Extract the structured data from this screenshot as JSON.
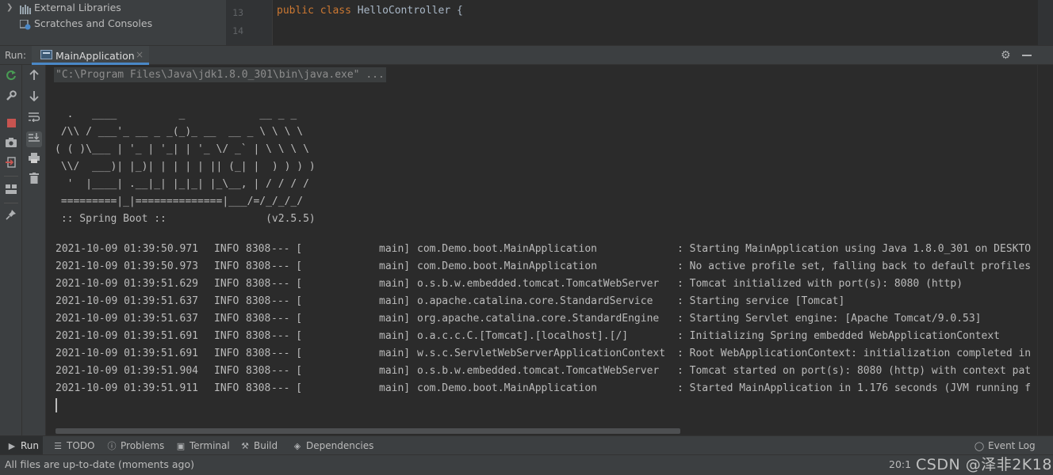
{
  "project_tree": {
    "items": [
      {
        "label": "External Libraries",
        "icon": "library-icon"
      },
      {
        "label": "Scratches and Consoles",
        "icon": "scratches-icon"
      }
    ]
  },
  "editor": {
    "line_numbers": [
      "13",
      "14"
    ],
    "line13": {
      "kw1": "public",
      "kw2": "class",
      "name": "HelloController",
      "brace": "{"
    }
  },
  "run_window": {
    "title": "Run:",
    "tab_label": "MainApplication",
    "tab_close": "×"
  },
  "console": {
    "command": "\"C:\\Program Files\\Java\\jdk1.8.0_301\\bin\\java.exe\" ...",
    "banner": [
      "  .   ____          _            __ _ _",
      " /\\\\ / ___'_ __ _ _(_)_ __  __ _ \\ \\ \\ \\",
      "( ( )\\___ | '_ | '_| | '_ \\/ _` | \\ \\ \\ \\",
      " \\\\/  ___)| |_)| | | | | || (_| |  ) ) ) )",
      "  '  |____| .__|_| |_|_| |_\\__, | / / / /",
      " =========|_|==============|___/=/_/_/_/",
      " :: Spring Boot ::                (v2.5.5)"
    ],
    "logs": [
      {
        "time": "2021-10-09 01:39:50.971",
        "level": "INFO",
        "pid": "8308",
        "sep": "--- [",
        "thread": "main]",
        "logger": "com.Demo.boot.MainApplication",
        "msg": ": Starting MainApplication using Java 1.8.0_301 on DESKTO"
      },
      {
        "time": "2021-10-09 01:39:50.973",
        "level": "INFO",
        "pid": "8308",
        "sep": "--- [",
        "thread": "main]",
        "logger": "com.Demo.boot.MainApplication",
        "msg": ": No active profile set, falling back to default profiles"
      },
      {
        "time": "2021-10-09 01:39:51.629",
        "level": "INFO",
        "pid": "8308",
        "sep": "--- [",
        "thread": "main]",
        "logger": "o.s.b.w.embedded.tomcat.TomcatWebServer",
        "msg": ": Tomcat initialized with port(s): 8080 (http)"
      },
      {
        "time": "2021-10-09 01:39:51.637",
        "level": "INFO",
        "pid": "8308",
        "sep": "--- [",
        "thread": "main]",
        "logger": "o.apache.catalina.core.StandardService",
        "msg": ": Starting service [Tomcat]"
      },
      {
        "time": "2021-10-09 01:39:51.637",
        "level": "INFO",
        "pid": "8308",
        "sep": "--- [",
        "thread": "main]",
        "logger": "org.apache.catalina.core.StandardEngine",
        "msg": ": Starting Servlet engine: [Apache Tomcat/9.0.53]"
      },
      {
        "time": "2021-10-09 01:39:51.691",
        "level": "INFO",
        "pid": "8308",
        "sep": "--- [",
        "thread": "main]",
        "logger": "o.a.c.c.C.[Tomcat].[localhost].[/]",
        "msg": ": Initializing Spring embedded WebApplicationContext"
      },
      {
        "time": "2021-10-09 01:39:51.691",
        "level": "INFO",
        "pid": "8308",
        "sep": "--- [",
        "thread": "main]",
        "logger": "w.s.c.ServletWebServerApplicationContext",
        "msg": ": Root WebApplicationContext: initialization completed in"
      },
      {
        "time": "2021-10-09 01:39:51.904",
        "level": "INFO",
        "pid": "8308",
        "sep": "--- [",
        "thread": "main]",
        "logger": "o.s.b.w.embedded.tomcat.TomcatWebServer",
        "msg": ": Tomcat started on port(s): 8080 (http) with context pat"
      },
      {
        "time": "2021-10-09 01:39:51.911",
        "level": "INFO",
        "pid": "8308",
        "sep": "--- [",
        "thread": "main]",
        "logger": "com.Demo.boot.MainApplication",
        "msg": ": Started MainApplication in 1.176 seconds (JVM running f"
      }
    ]
  },
  "bottom_tabs": [
    {
      "label": "Run",
      "icon": "run-icon",
      "active": true
    },
    {
      "label": "TODO",
      "icon": "todo-icon"
    },
    {
      "label": "Problems",
      "icon": "problems-icon"
    },
    {
      "label": "Terminal",
      "icon": "terminal-icon"
    },
    {
      "label": "Build",
      "icon": "build-icon"
    },
    {
      "label": "Dependencies",
      "icon": "dependencies-icon"
    },
    {
      "label": "Event Log",
      "icon": "event-log-icon"
    }
  ],
  "status": {
    "message": "All files are up-to-date (moments ago)",
    "position": "20:1",
    "watermark": "CSDN @泽非2K18"
  },
  "colors": {
    "keyword": "#cc7832",
    "stop_red": "#c75450",
    "rerun_green": "#499c54",
    "tab_underline": "#4a88c7"
  }
}
